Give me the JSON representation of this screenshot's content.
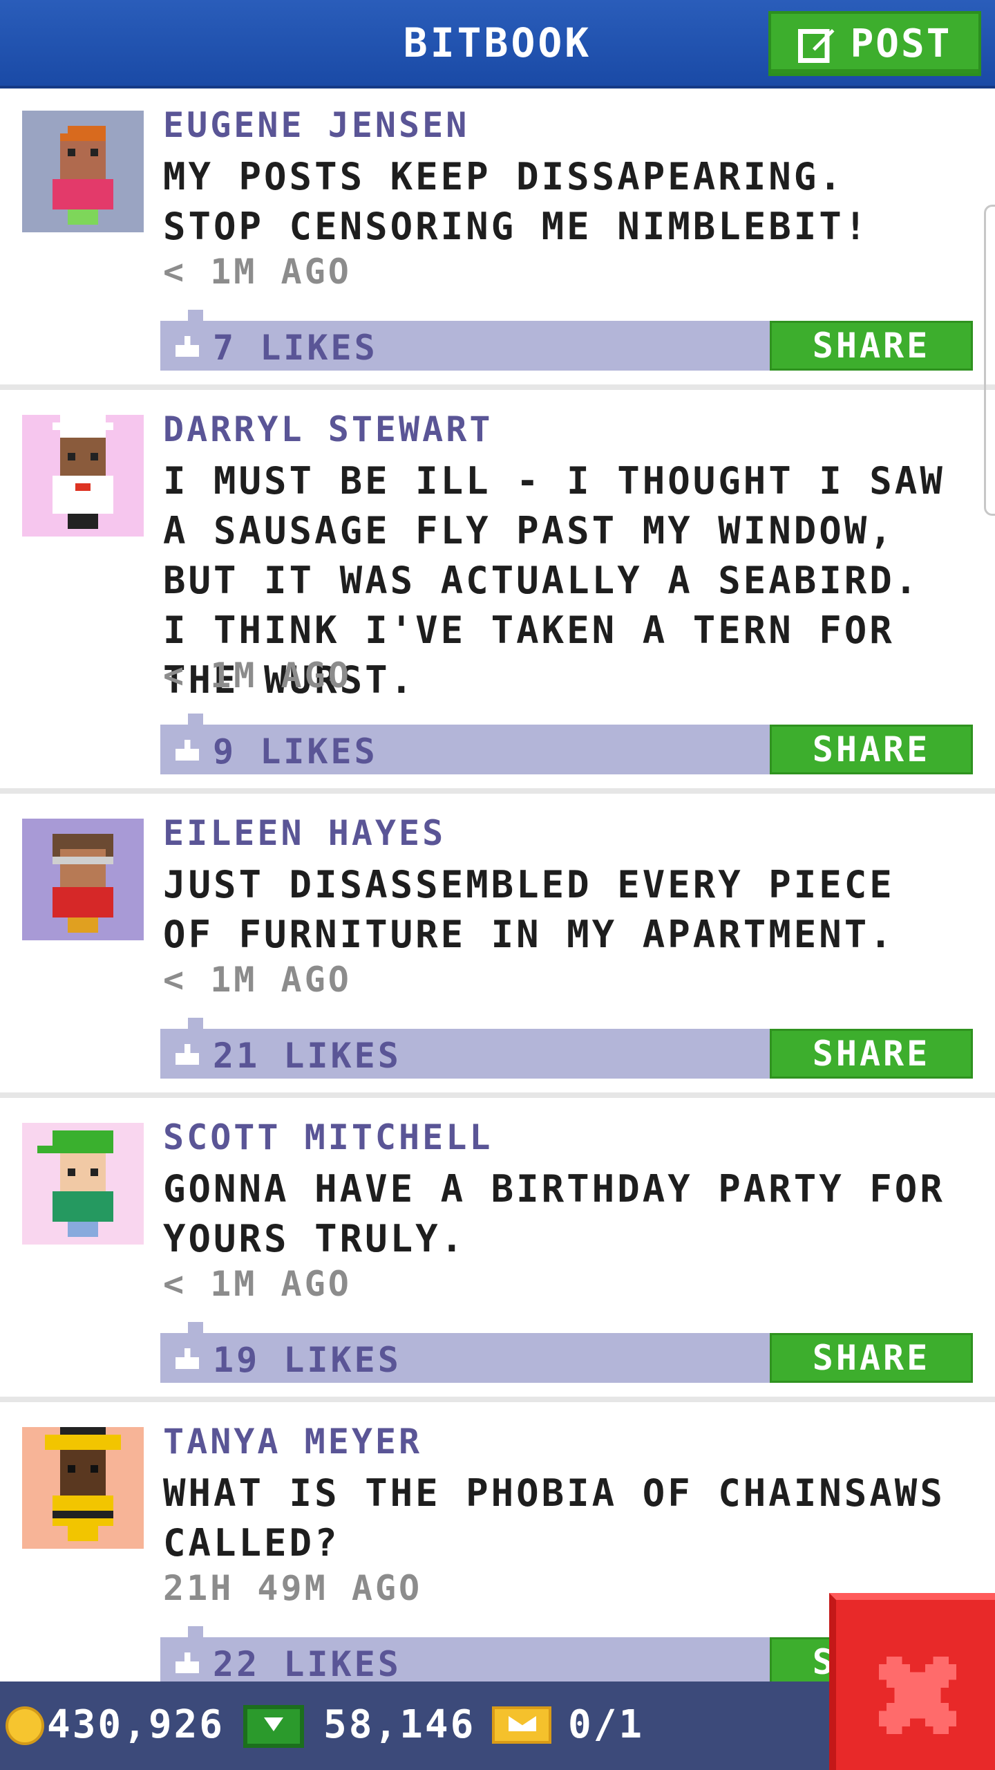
{
  "header": {
    "title": "BITBOOK",
    "post_label": "POST"
  },
  "posts": [
    {
      "name": "EUGENE JENSEN",
      "text": "MY POSTS KEEP DISSAPEARING. STOP CENSORING ME NIMBLEBIT!",
      "time": "< 1M AGO",
      "likes": "7 LIKES",
      "share": "SHARE"
    },
    {
      "name": "DARRYL STEWART",
      "text": "I MUST BE ILL - I THOUGHT I SAW A SAUSAGE FLY PAST MY WINDOW, BUT IT WAS ACTUALLY A SEABIRD. I THINK I'VE TAKEN A TERN FOR THE WURST.",
      "time": "< 1M AGO",
      "likes": "9 LIKES",
      "share": "SHARE"
    },
    {
      "name": "EILEEN HAYES",
      "text": "JUST DISASSEMBLED EVERY PIECE OF FURNITURE IN MY APARTMENT.",
      "time": "< 1M AGO",
      "likes": "21 LIKES",
      "share": "SHARE"
    },
    {
      "name": "SCOTT MITCHELL",
      "text": "GONNA HAVE A BIRTHDAY PARTY FOR YOURS TRULY.",
      "time": "< 1M AGO",
      "likes": "19 LIKES",
      "share": "SHARE"
    },
    {
      "name": "TANYA MEYER",
      "text": "WHAT IS THE PHOBIA OF CHAINSAWS CALLED?",
      "time": "21H 49M AGO",
      "likes": "22 LIKES",
      "share": "SHARE"
    }
  ],
  "footer": {
    "coins": "430,926",
    "bux": "58,146",
    "tickets": "0/1"
  },
  "colors": {
    "header": "#1a4aa6",
    "green": "#3dae2d",
    "likebar": "#b3b5d8",
    "name": "#5a5596",
    "close": "#e82929"
  }
}
